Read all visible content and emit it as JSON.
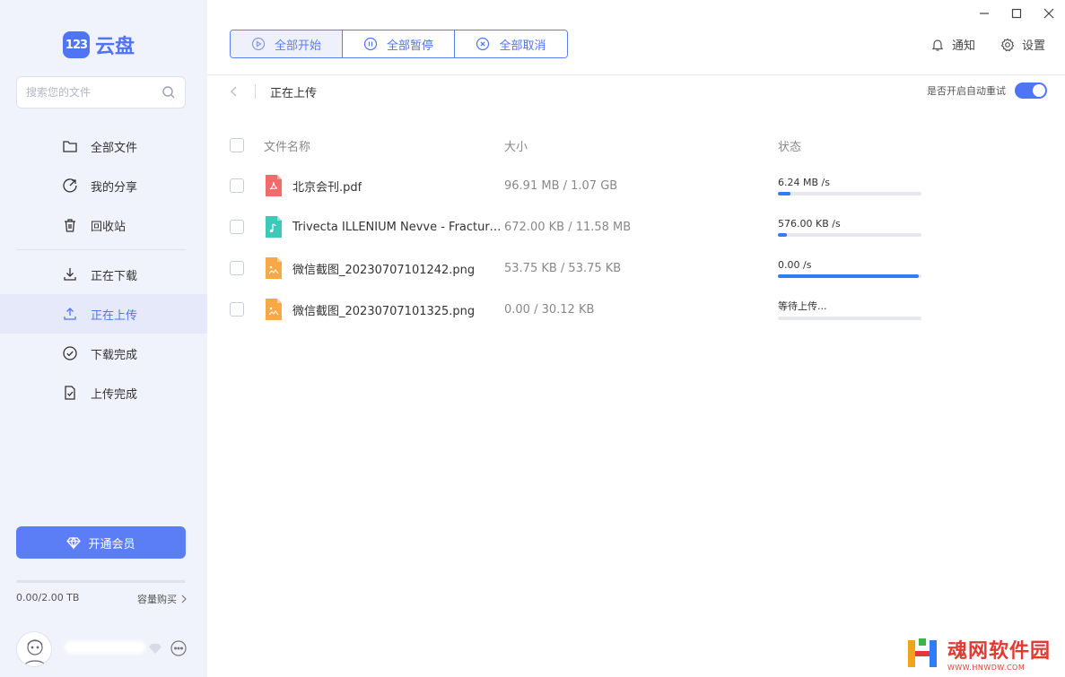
{
  "app": {
    "logo_badge": "123",
    "logo_text": "云盘"
  },
  "search": {
    "placeholder": "搜索您的文件"
  },
  "nav": {
    "items": [
      {
        "label": "全部文件",
        "icon": "folder-icon"
      },
      {
        "label": "我的分享",
        "icon": "share-icon"
      },
      {
        "label": "回收站",
        "icon": "trash-icon"
      },
      {
        "label": "正在下载",
        "icon": "download-icon"
      },
      {
        "label": "正在上传",
        "icon": "upload-icon",
        "active": true
      },
      {
        "label": "下载完成",
        "icon": "check-circle-icon"
      },
      {
        "label": "上传完成",
        "icon": "file-check-icon"
      }
    ]
  },
  "vip": {
    "label": "开通会员"
  },
  "storage": {
    "used_text": "0.00/2.00 TB",
    "buy_label": "容量购买",
    "used_fraction": 0.0
  },
  "toolbar": {
    "start_all": "全部开始",
    "pause_all": "全部暂停",
    "cancel_all": "全部取消"
  },
  "top": {
    "notify": "通知",
    "settings": "设置"
  },
  "breadcrumb": {
    "title": "正在上传"
  },
  "auto_retry": {
    "label": "是否开启自动重试",
    "enabled": true
  },
  "table": {
    "headers": {
      "name": "文件名称",
      "size": "大小",
      "status": "状态"
    },
    "rows": [
      {
        "name": "北京会刊.pdf",
        "type": "pdf",
        "size": "96.91 MB / 1.07 GB",
        "status": "6.24 MB /s",
        "progress": 0.09
      },
      {
        "name": "Trivecta ILLENIUM Nevve - Fractures T...",
        "type": "audio",
        "size": "672.00 KB / 11.58 MB",
        "status": "576.00 KB /s",
        "progress": 0.06
      },
      {
        "name": "微信截图_20230707101242.png",
        "type": "image",
        "size": "53.75 KB / 53.75 KB",
        "status": "0.00 /s",
        "progress": 0.98
      },
      {
        "name": "微信截图_20230707101325.png",
        "type": "image",
        "size": "0.00 / 30.12 KB",
        "status": "等待上传...",
        "progress": 0.0
      }
    ]
  },
  "watermark": {
    "title": "魂网软件园",
    "url": "WWW.HNWDW.COM"
  },
  "colors": {
    "accent": "#4f74f5",
    "progress": "#2e7cf6",
    "sidebar_bg": "#f1f3fc",
    "pdf": "#f26b6b",
    "audio": "#3ec8b8",
    "image": "#f8a844"
  }
}
